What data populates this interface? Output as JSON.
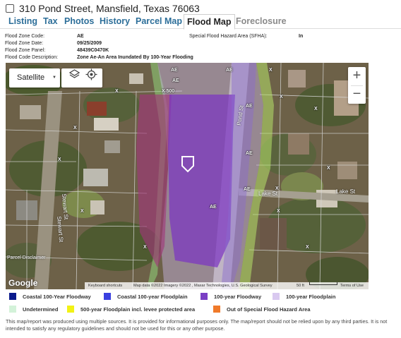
{
  "property": {
    "address": "310 Pond Street, Mansfield, Texas 76063"
  },
  "tabs": [
    {
      "label": "Listing",
      "state": "normal"
    },
    {
      "label": "Tax",
      "state": "normal"
    },
    {
      "label": "Photos",
      "state": "normal"
    },
    {
      "label": "History",
      "state": "normal"
    },
    {
      "label": "Parcel Map",
      "state": "normal"
    },
    {
      "label": "Flood Map",
      "state": "active"
    },
    {
      "label": "Foreclosure",
      "state": "disabled"
    }
  ],
  "flood_info": {
    "zone_code_label": "Flood Zone Code:",
    "zone_code": "AE",
    "zone_date_label": "Flood Zone Date:",
    "zone_date": "09/25/2009",
    "zone_panel_label": "Flood Zone Panel:",
    "zone_panel": "48439C0470K",
    "code_description_label": "Flood Code Description:",
    "code_description": "Zone Ae-An Area Inundated By 100-Year Flooding",
    "sfha_label": "Special Flood Hazard Area (SFHA):",
    "sfha": "In"
  },
  "map": {
    "map_type": "Satellite",
    "zoom_in": "+",
    "zoom_out": "−",
    "zone_labels": [
      "AE",
      "AE",
      "AE",
      "AE",
      "AE",
      "AE",
      "AE"
    ],
    "x_labels": [
      "X",
      "X",
      "X",
      "X",
      "X",
      "X",
      "X",
      "X",
      "X",
      "X",
      "X",
      "X"
    ],
    "x500_label": "X 500",
    "streets": [
      "Pond St",
      "Lake St",
      "Lake St",
      "Stewart St",
      "Stewart St",
      "Parcel Disclaimer"
    ],
    "google_logo": "Google",
    "attribution": {
      "shortcuts": "Keyboard shortcuts",
      "data": "Map data ©2022 Imagery ©2022 , Maxar Technologies, U.S. Geological Survey",
      "scale": "50 ft",
      "terms": "Terms of Use"
    },
    "icons": [
      "layers-icon",
      "locate-icon",
      "property-marker-icon"
    ]
  },
  "legend": [
    {
      "label": "Coastal 100-Year Floodway",
      "color": "#0a1a8c"
    },
    {
      "label": "Coastal 100-year Floodplain",
      "color": "#3a40e0"
    },
    {
      "label": "100-year Floodway",
      "color": "#7a3fc4"
    },
    {
      "label": "100-year Floodplain",
      "color": "#d9c9f0"
    },
    {
      "label": "Undetermined",
      "color": "#d3f2d9"
    },
    {
      "label": "500-year Floodplain incl. levee protected area",
      "color": "#f2f215"
    },
    {
      "label": "Out of Special Flood Hazard Area",
      "color": "#f07a2a"
    }
  ],
  "disclaimer": "This map/report was produced using multiple sources. It is provided for informational purposes only. The map/report should not be relied upon by any third parties. It is not intended to satisfy any regulatory guidelines and should not be used for this or any other purpose."
}
